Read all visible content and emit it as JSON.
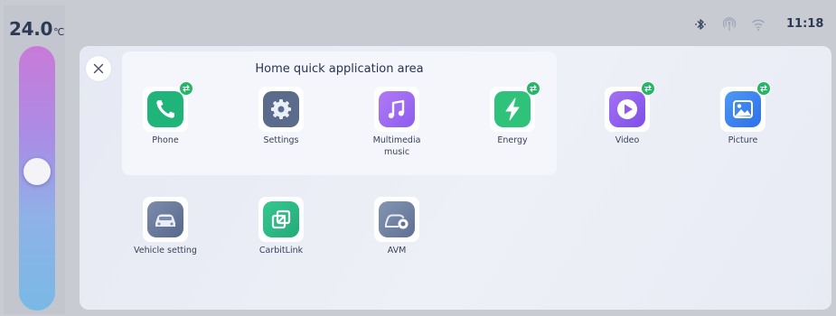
{
  "climate": {
    "temperature": "24.0",
    "unit": "℃",
    "level": 0.53
  },
  "status_bar": {
    "icons": [
      "bluetooth-icon",
      "signal-icon",
      "wifi-icon"
    ],
    "time": "11:18"
  },
  "quick_area": {
    "title": "Home quick application area"
  },
  "apps": [
    {
      "label": "Phone",
      "icon": "phone-icon",
      "color": "#1fb47a",
      "badge": true
    },
    {
      "label": "Settings",
      "icon": "gear-icon",
      "color": "#5a6b8c",
      "badge": false
    },
    {
      "label": "Multimedia music",
      "icon": "music-note-icon",
      "color": "#9a6cf0",
      "badge": false
    },
    {
      "label": "Energy",
      "icon": "lightning-icon",
      "color": "#2fc27a",
      "badge": true
    },
    {
      "label": "Video",
      "icon": "play-icon",
      "color": "#8e5cf0",
      "badge": true
    },
    {
      "label": "Picture",
      "icon": "picture-icon",
      "color": "#3d84f0",
      "badge": true
    },
    {
      "label": "Vehicle setting",
      "icon": "car-icon",
      "color": "#67799c",
      "badge": false
    },
    {
      "label": "CarbitLink",
      "icon": "link-icon",
      "color": "#2dbe8c",
      "badge": false
    },
    {
      "label": "AVM",
      "icon": "camera-car-icon",
      "color": "#6f7f9f",
      "badge": false
    }
  ],
  "colors": {
    "badge": "#27b569",
    "text": "#2c3a56"
  }
}
